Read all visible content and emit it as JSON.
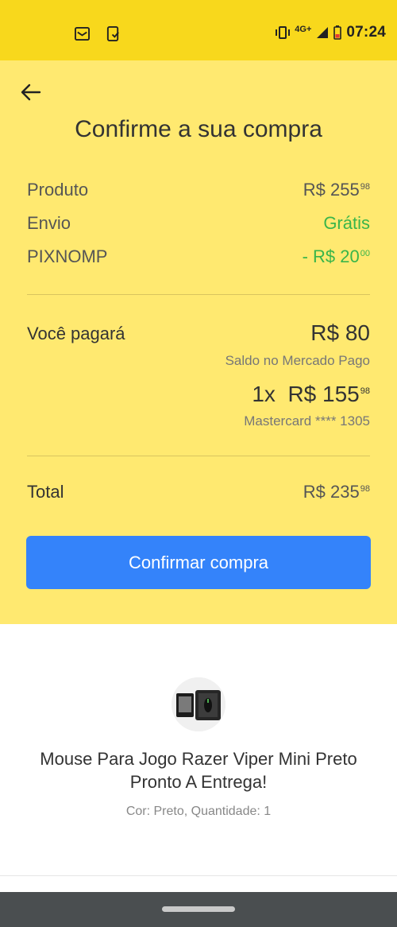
{
  "status_bar": {
    "time": "07:24",
    "network": "4G+",
    "icons": [
      "mail-icon",
      "phone-icon",
      "vibrate-icon",
      "signal-icon",
      "battery-icon"
    ]
  },
  "header": {
    "title": "Confirme a sua compra"
  },
  "summary": {
    "product_label": "Produto",
    "product_value": "R$ 255",
    "product_cents": "98",
    "shipping_label": "Envio",
    "shipping_value": "Grátis",
    "coupon_label": "PIXNOMP",
    "coupon_value": "- R$ 20",
    "coupon_cents": "00"
  },
  "payment": {
    "label": "Você pagará",
    "balance_amount": "R$ 80",
    "balance_source": "Saldo no Mercado Pago",
    "installments": "1x",
    "card_amount": "R$ 155",
    "card_cents": "98",
    "card_info": "Mastercard **** 1305"
  },
  "total": {
    "label": "Total",
    "value": "R$ 235",
    "cents": "98"
  },
  "confirm_button": "Confirmar compra",
  "product": {
    "title": "Mouse Para Jogo Razer Viper Mini Preto Pronto A Entrega!",
    "details": "Cor: Preto, Quantidade: 1"
  },
  "colors": {
    "header_yellow": "#f8d81c",
    "panel_yellow": "#ffe970",
    "accent_blue": "#3483fa",
    "success_green": "#39b54a"
  }
}
